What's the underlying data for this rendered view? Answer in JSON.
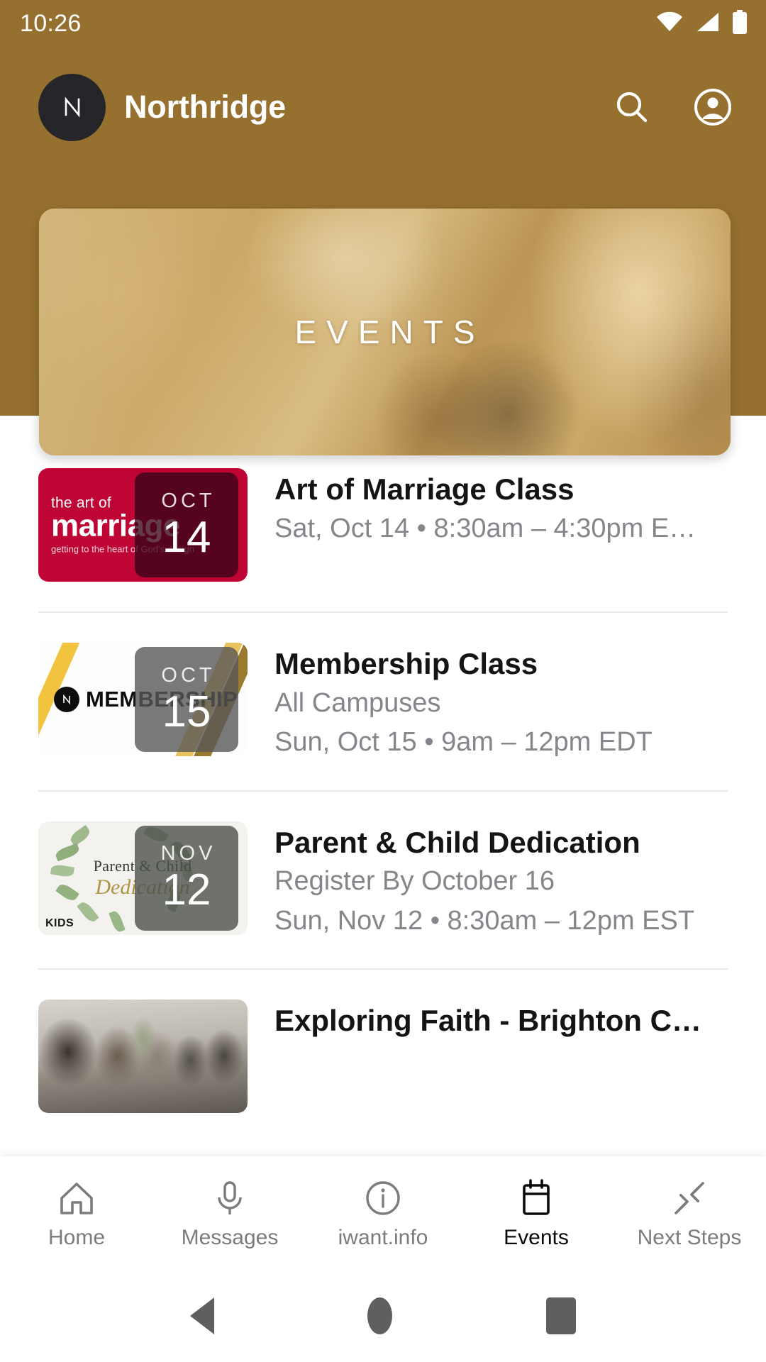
{
  "status_bar": {
    "time": "10:26",
    "icons": [
      "wifi-icon",
      "cellular-signal-icon",
      "battery-icon"
    ]
  },
  "header": {
    "logo_letter": "N",
    "logo_name": "northridge-logo-icon",
    "title": "Northridge",
    "actions": [
      {
        "name": "search-icon",
        "label": "Search"
      },
      {
        "name": "account-circle-icon",
        "label": "Account"
      }
    ],
    "background_color": "#96702f"
  },
  "hero": {
    "label": "EVENTS",
    "image_description": "golden-toned photo of people",
    "overlay_color": "#c6a059"
  },
  "events": [
    {
      "title": "Art of Marriage Class",
      "subtitle_1": "Sat, Oct 14 • 8:30am – 4:30pm E…",
      "subtitle_2": "",
      "badge_month": "OCT",
      "badge_day": "14",
      "thumb_style": "marriage",
      "thumb_text": {
        "line1": "the art of",
        "line2": "marriage",
        "line3": "getting to the heart of God's design"
      },
      "thumb_color": "#bf0436"
    },
    {
      "title": "Membership Class",
      "subtitle_1": "All Campuses",
      "subtitle_2": "Sun, Oct 15 • 9am – 12pm EDT",
      "badge_month": "OCT",
      "badge_day": "15",
      "thumb_style": "membership",
      "thumb_text": {
        "logo_letter": "N",
        "wordmark": "MEMBERSHIP"
      },
      "thumb_color": "#fdfdfd"
    },
    {
      "title": "Parent & Child Dedication",
      "subtitle_1": "Register By October 16",
      "subtitle_2": "Sun, Nov 12 • 8:30am – 12pm EST",
      "badge_month": "NOV",
      "badge_day": "12",
      "thumb_style": "dedication",
      "thumb_text": {
        "line1": "Parent & Child",
        "line2": "Dedication",
        "badge": "KIDS"
      },
      "thumb_color": "#f3f2ee"
    },
    {
      "title": "Exploring Faith - Brighton C…",
      "subtitle_1": "",
      "subtitle_2": "",
      "badge_month": "",
      "badge_day": "",
      "thumb_style": "faith-photo",
      "thumb_text": {},
      "thumb_color": "#8e877e"
    }
  ],
  "bottom_nav": {
    "items": [
      {
        "label": "Home",
        "icon": "home-icon",
        "active": false
      },
      {
        "label": "Messages",
        "icon": "microphone-icon",
        "active": false
      },
      {
        "label": "iwant.info",
        "icon": "info-circle-icon",
        "active": false
      },
      {
        "label": "Events",
        "icon": "calendar-icon",
        "active": true
      },
      {
        "label": "Next Steps",
        "icon": "arrows-in-icon",
        "active": false
      }
    ],
    "active_color": "#0b0b0b",
    "inactive_color": "#7c7c7c"
  },
  "system_nav": {
    "back": "back-button",
    "home": "home-button",
    "recents": "recents-button"
  }
}
